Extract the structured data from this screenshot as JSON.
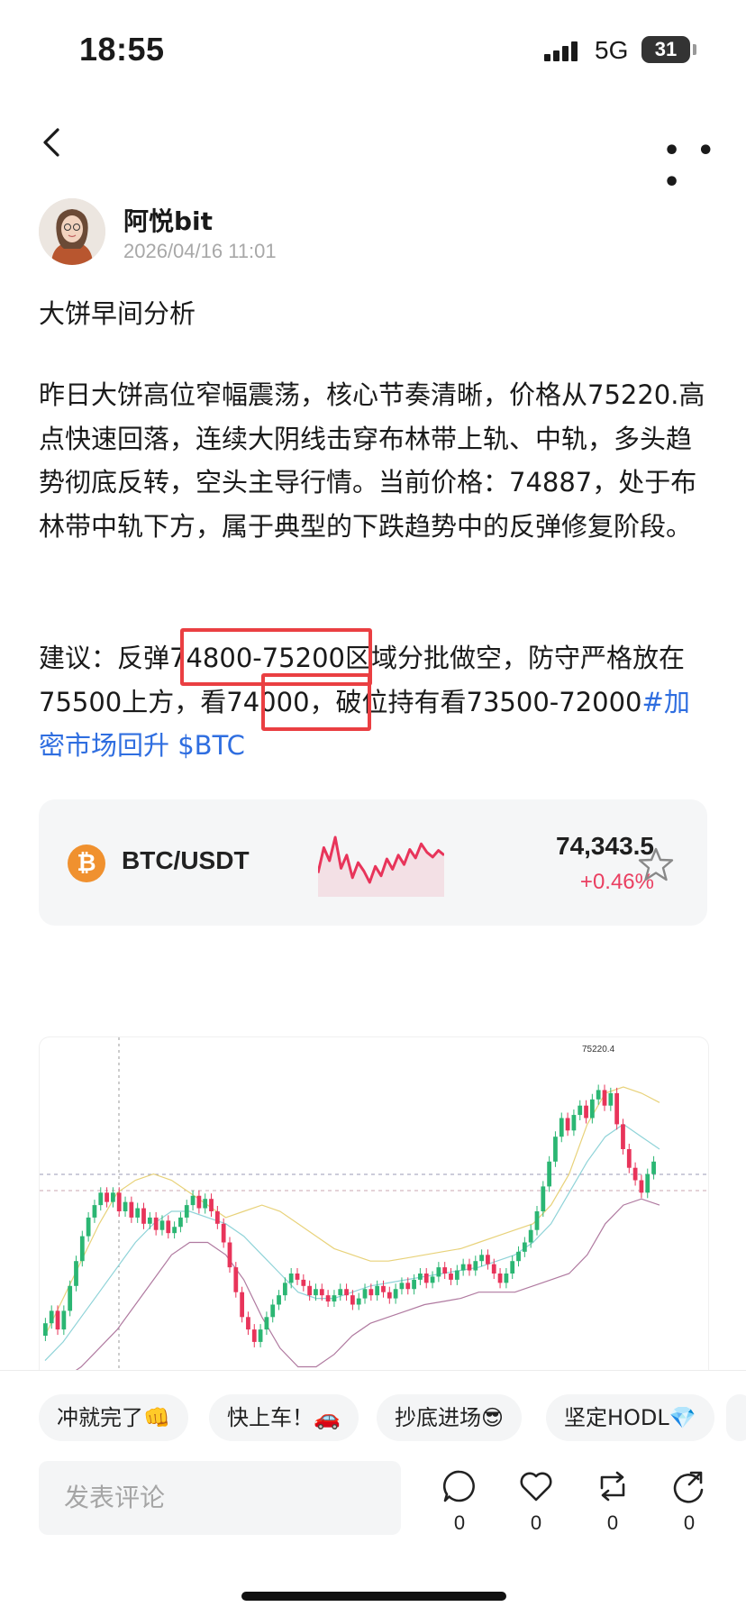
{
  "status_bar": {
    "time": "18:55",
    "network": "5G",
    "battery": "31"
  },
  "author": {
    "name": "阿悦bit",
    "timestamp": "2026/04/16 11:01"
  },
  "post": {
    "title": "大饼早间分析",
    "paragraph1": "昨日大饼高位窄幅震荡，核心节奏清晰，价格从75220.高点快速回落，连续大阴线击穿布林带上轨、中轨，多头趋势彻底反转，空头主导行情。当前价格：74887，处于布林带中轨下方，属于典型的下跌趋势中的反弹修复阶段。",
    "advice_prefix": "建议：反弹",
    "advice_range": "74800-75200",
    "advice_mid": "区域分批做空，防守严格放在75500上方，看",
    "advice_target": "74000",
    "advice_suffix": "，破位持有看73500-72000",
    "hashtag": "#加密市场回升 $BTC",
    "highlight_color": "#ea3f42",
    "hashtag_color": "#2f6ee0"
  },
  "ticker": {
    "icon": "bitcoin-icon",
    "pair": "BTC/USDT",
    "price": "74,343.5",
    "change": "+0.46%",
    "change_color": "#ea3f61",
    "sparkline": [
      74110,
      74380,
      74240,
      74490,
      74160,
      74300,
      74060,
      74220,
      74130,
      74010,
      74180,
      74080,
      74260,
      74150,
      74300,
      74200,
      74360,
      74270,
      74420,
      74330,
      74280,
      74350,
      74300
    ]
  },
  "chart": {
    "peak_label": "75220.4",
    "candles": [
      [
        20,
        24
      ],
      [
        24,
        28
      ],
      [
        28,
        22
      ],
      [
        22,
        28
      ],
      [
        28,
        36
      ],
      [
        36,
        44
      ],
      [
        44,
        52
      ],
      [
        52,
        58
      ],
      [
        58,
        62
      ],
      [
        62,
        66
      ],
      [
        66,
        63
      ],
      [
        63,
        66
      ],
      [
        66,
        60
      ],
      [
        60,
        63
      ],
      [
        63,
        58
      ],
      [
        58,
        61
      ],
      [
        61,
        56
      ],
      [
        56,
        58
      ],
      [
        58,
        54
      ],
      [
        54,
        57
      ],
      [
        57,
        53
      ],
      [
        53,
        55
      ],
      [
        55,
        58
      ],
      [
        58,
        62
      ],
      [
        62,
        65
      ],
      [
        65,
        61
      ],
      [
        61,
        64
      ],
      [
        64,
        60
      ],
      [
        60,
        56
      ],
      [
        56,
        50
      ],
      [
        50,
        42
      ],
      [
        42,
        34
      ],
      [
        34,
        26
      ],
      [
        26,
        22
      ],
      [
        22,
        18
      ],
      [
        18,
        22
      ],
      [
        22,
        26
      ],
      [
        26,
        30
      ],
      [
        30,
        33
      ],
      [
        33,
        37
      ],
      [
        37,
        40
      ],
      [
        40,
        38
      ],
      [
        38,
        36
      ],
      [
        36,
        33
      ],
      [
        33,
        35
      ],
      [
        35,
        33
      ],
      [
        33,
        31
      ],
      [
        31,
        33
      ],
      [
        33,
        35
      ],
      [
        35,
        33
      ],
      [
        33,
        30
      ],
      [
        30,
        32
      ],
      [
        32,
        35
      ],
      [
        35,
        33
      ],
      [
        33,
        36
      ],
      [
        36,
        34
      ],
      [
        34,
        32
      ],
      [
        32,
        35
      ],
      [
        35,
        37
      ],
      [
        37,
        35
      ],
      [
        35,
        38
      ],
      [
        38,
        40
      ],
      [
        40,
        37
      ],
      [
        37,
        39
      ],
      [
        39,
        42
      ],
      [
        42,
        40
      ],
      [
        40,
        38
      ],
      [
        38,
        41
      ],
      [
        41,
        43
      ],
      [
        43,
        41
      ],
      [
        41,
        44
      ],
      [
        44,
        46
      ],
      [
        46,
        43
      ],
      [
        43,
        40
      ],
      [
        40,
        37
      ],
      [
        37,
        40
      ],
      [
        40,
        44
      ],
      [
        44,
        47
      ],
      [
        47,
        50
      ],
      [
        50,
        54
      ],
      [
        54,
        60
      ],
      [
        60,
        68
      ],
      [
        68,
        76
      ],
      [
        76,
        84
      ],
      [
        84,
        90
      ],
      [
        90,
        86
      ],
      [
        86,
        91
      ],
      [
        91,
        94
      ],
      [
        94,
        90
      ],
      [
        90,
        96
      ],
      [
        96,
        99
      ],
      [
        99,
        94
      ],
      [
        94,
        98
      ],
      [
        98,
        88
      ],
      [
        88,
        80
      ],
      [
        80,
        74
      ],
      [
        74,
        70
      ],
      [
        70,
        66
      ],
      [
        66,
        72
      ],
      [
        72,
        76
      ]
    ],
    "bollinger_upper": [
      20,
      32,
      44,
      56,
      66,
      70,
      72,
      70,
      66,
      62,
      58,
      60,
      62,
      60,
      56,
      52,
      48,
      46,
      44,
      44,
      45,
      46,
      47,
      48,
      50,
      52,
      54,
      56,
      62,
      72,
      88,
      98,
      100,
      98,
      95
    ],
    "bollinger_mid": [
      12,
      18,
      26,
      34,
      42,
      50,
      56,
      60,
      60,
      58,
      56,
      52,
      46,
      40,
      34,
      32,
      32,
      34,
      36,
      37,
      38,
      39,
      40,
      41,
      42,
      44,
      46,
      50,
      56,
      66,
      76,
      84,
      88,
      84,
      80
    ],
    "bollinger_lower": [
      4,
      6,
      10,
      16,
      22,
      30,
      38,
      46,
      50,
      50,
      46,
      38,
      26,
      16,
      10,
      10,
      14,
      20,
      24,
      26,
      28,
      30,
      31,
      32,
      34,
      34,
      34,
      36,
      38,
      40,
      46,
      56,
      62,
      64,
      62
    ]
  },
  "quick_reactions": [
    "冲就完了👊",
    "快上车！🚗",
    "抄底进场😎",
    "坚定HODL💎"
  ],
  "comment": {
    "placeholder": "发表评论"
  },
  "actions": [
    {
      "icon": "comment-icon",
      "count": "0"
    },
    {
      "icon": "heart-icon",
      "count": "0"
    },
    {
      "icon": "repost-icon",
      "count": "0"
    },
    {
      "icon": "share-icon",
      "count": "0"
    }
  ]
}
